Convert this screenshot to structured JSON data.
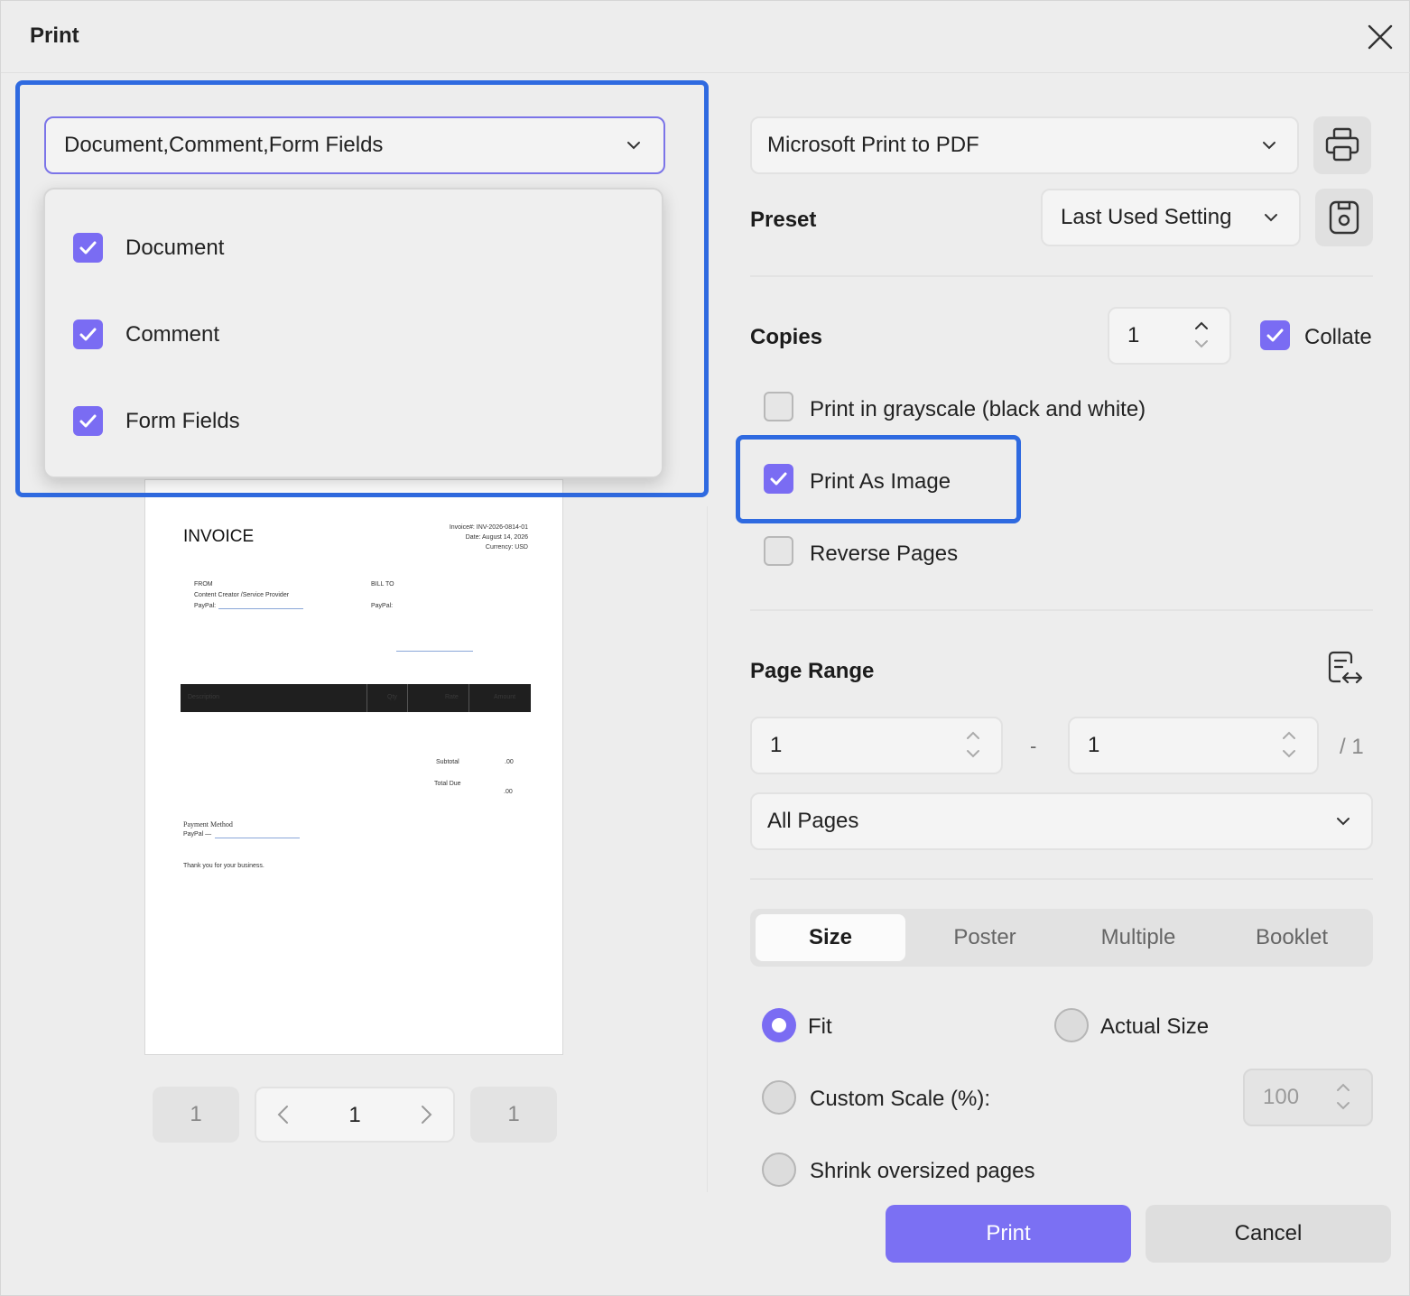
{
  "window": {
    "title": "Print"
  },
  "content_select": {
    "value": "Document,Comment,Form Fields",
    "options": [
      {
        "label": "Document",
        "checked": true
      },
      {
        "label": "Comment",
        "checked": true
      },
      {
        "label": "Form Fields",
        "checked": true
      }
    ]
  },
  "preview": {
    "invoice_title": "INVOICE",
    "invoice_meta": [
      "Invoice#: INV-2026-0814-01",
      "Date: August 14, 2026",
      "Currency: USD"
    ],
    "from_label": "FROM",
    "from_name": "Content Creator /Service Provider",
    "from_paypal": "PayPal:",
    "bill_to_label": "BILL TO",
    "bill_to_paypal": "PayPal:",
    "table_headers": [
      "Description",
      "Qty",
      "Rate",
      "Amount"
    ],
    "subtotal_label": "Subtotal",
    "subtotal_value": ".00",
    "total_label": "Total Due",
    "total_value": ".00",
    "payment_method_label": "Payment Method",
    "payment_paypal": "PayPal —",
    "thanks": "Thank you for your business."
  },
  "pager": {
    "first": "1",
    "current": "1",
    "last": "1"
  },
  "printer": {
    "value": "Microsoft Print to PDF"
  },
  "preset": {
    "label": "Preset",
    "value": "Last Used Setting"
  },
  "copies": {
    "label": "Copies",
    "value": "1",
    "collate_label": "Collate",
    "collate_checked": true
  },
  "options": {
    "grayscale": {
      "label": "Print in grayscale (black and white)",
      "checked": false
    },
    "as_image": {
      "label": "Print As Image",
      "checked": true
    },
    "reverse": {
      "label": "Reverse Pages",
      "checked": false
    }
  },
  "page_range": {
    "label": "Page Range",
    "from": "1",
    "dash": "-",
    "to": "1",
    "total": "/ 1",
    "subset": "All Pages"
  },
  "tabs": [
    {
      "label": "Size",
      "active": true
    },
    {
      "label": "Poster",
      "active": false
    },
    {
      "label": "Multiple",
      "active": false
    },
    {
      "label": "Booklet",
      "active": false
    }
  ],
  "size_options": {
    "fit": {
      "label": "Fit",
      "selected": true
    },
    "actual": {
      "label": "Actual Size",
      "selected": false
    },
    "custom": {
      "label": "Custom Scale (%):",
      "selected": false,
      "value": "100"
    },
    "shrink": {
      "label": "Shrink oversized pages",
      "selected": false
    }
  },
  "buttons": {
    "print": "Print",
    "cancel": "Cancel"
  },
  "colors": {
    "accent": "#7a6cf3",
    "highlight": "#2f6ae0"
  }
}
